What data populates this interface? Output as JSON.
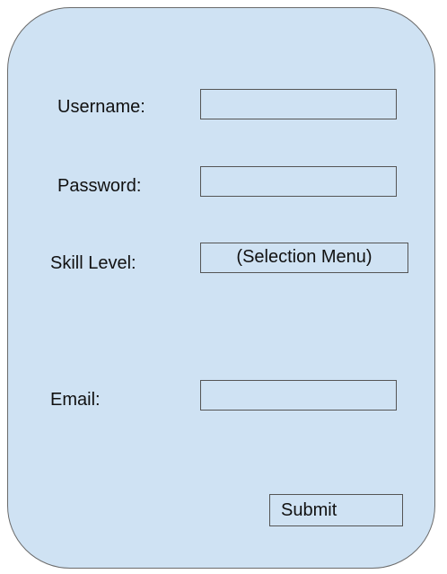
{
  "form": {
    "username_label": "Username:",
    "username_value": "",
    "password_label": "Password:",
    "password_value": "",
    "skill_label": "Skill Level:",
    "skill_value": "(Selection Menu)",
    "email_label": "Email:",
    "email_value": "",
    "submit_label": "Submit"
  }
}
